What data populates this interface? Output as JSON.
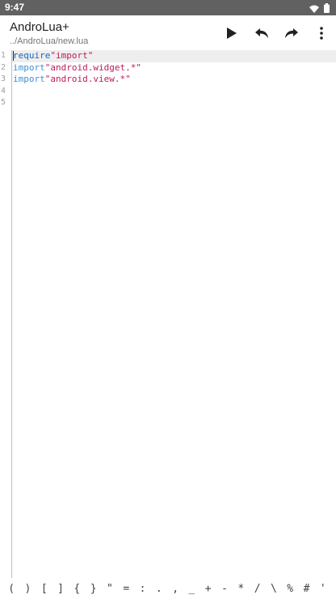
{
  "status_bar": {
    "time": "9:47",
    "icons": [
      "wifi-icon",
      "battery-icon"
    ]
  },
  "app_bar": {
    "title": "AndroLua+",
    "subtitle": "../AndroLua/new.lua",
    "actions": [
      "play-icon",
      "undo-icon",
      "redo-icon",
      "more-vert-icon"
    ]
  },
  "editor": {
    "line_numbers": [
      "1",
      "2",
      "3",
      "4",
      "5"
    ],
    "lines": [
      {
        "keyword": "require",
        "string": "\"import\""
      },
      {
        "keyword": "import",
        "string": "\"android.widget.*\""
      },
      {
        "keyword": "import",
        "string": "\"android.view.*\""
      },
      {
        "keyword": "",
        "string": ""
      },
      {
        "keyword": "",
        "string": ""
      }
    ]
  },
  "symbol_bar": {
    "symbols": [
      "(",
      ")",
      "[",
      "]",
      "{",
      "}",
      "\"",
      "=",
      ":",
      ".",
      ",",
      "_",
      "+",
      "-",
      "*",
      "/",
      "\\",
      "%",
      "#",
      "'"
    ]
  },
  "colors": {
    "status_bar": "#616161",
    "keyword_require": "#1565c0",
    "keyword_import": "#3f8fd8",
    "string": "#c2185b"
  }
}
